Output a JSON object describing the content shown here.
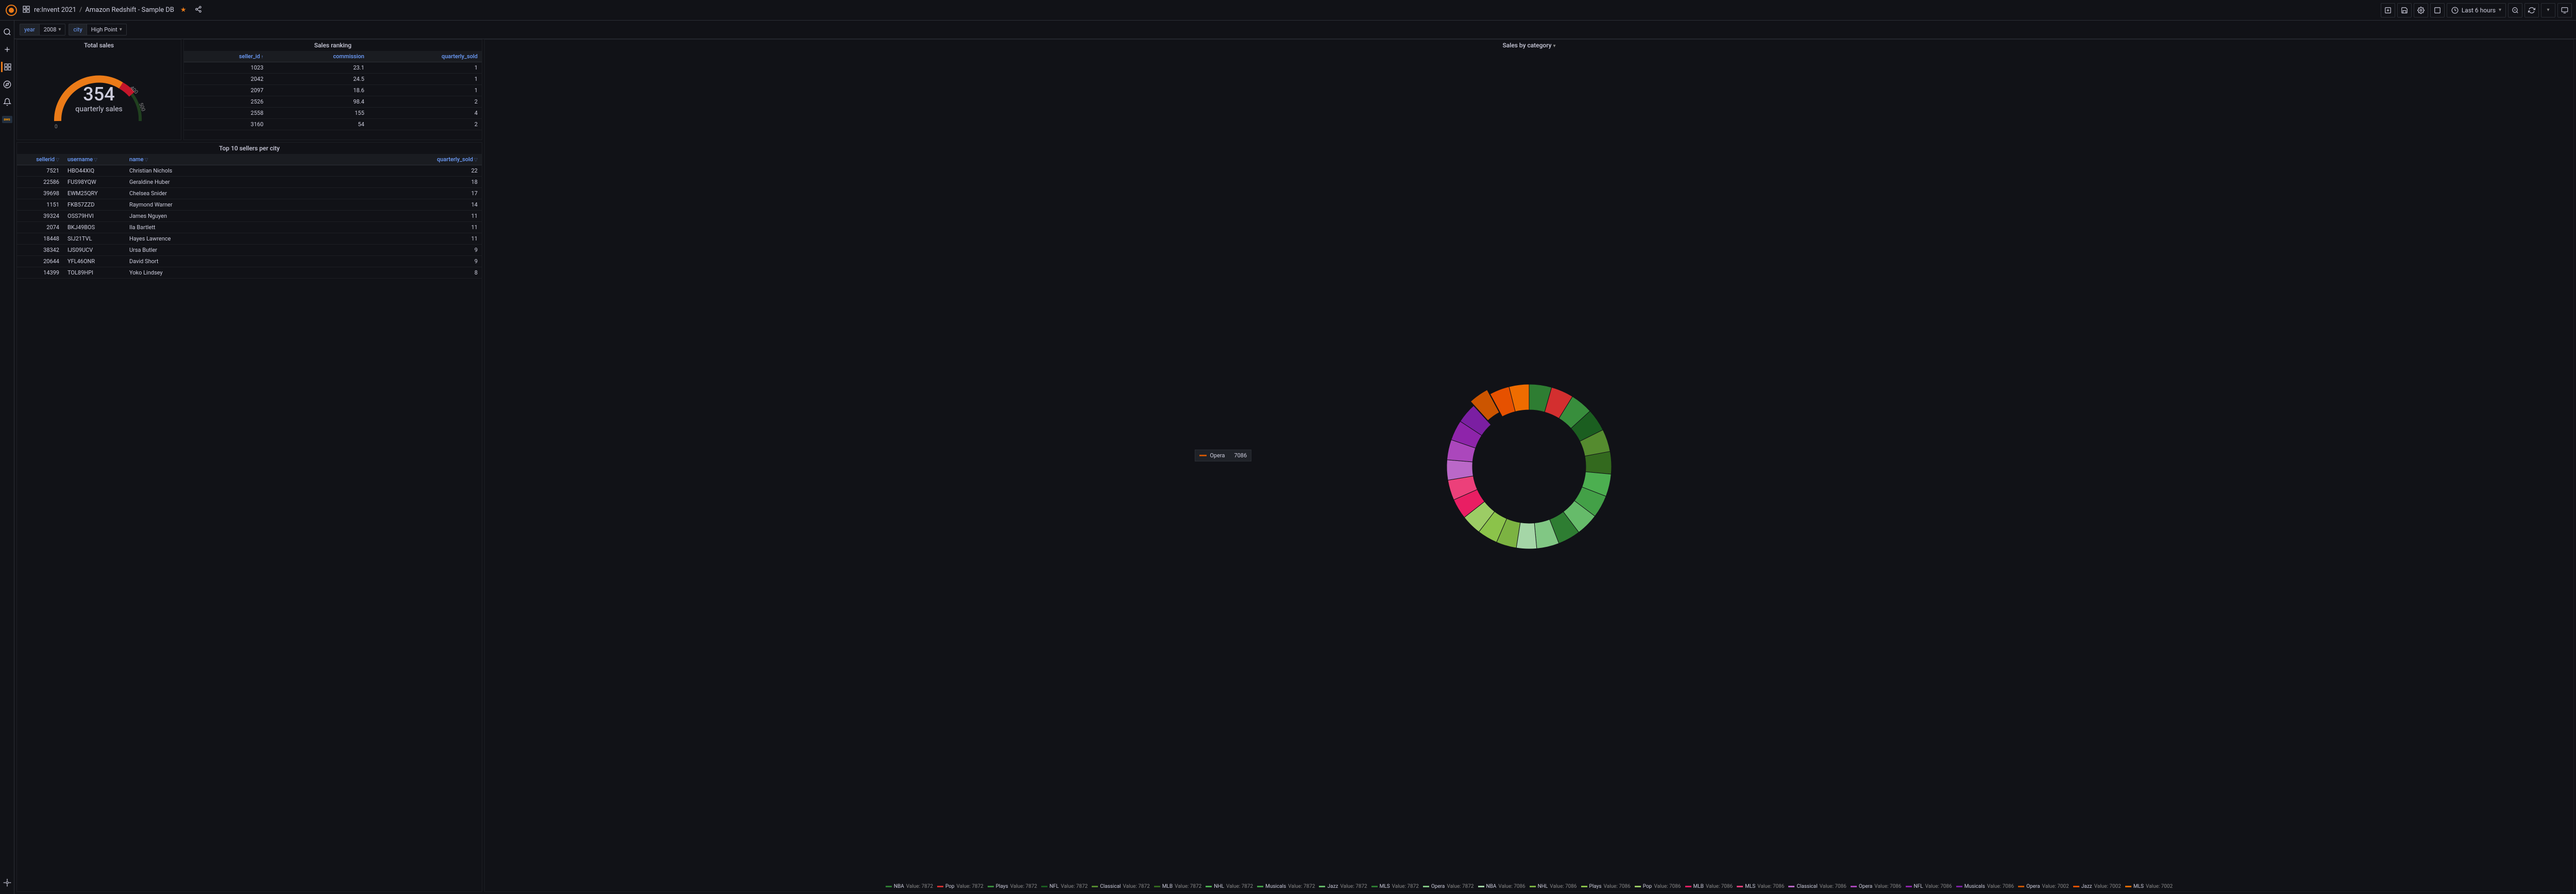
{
  "breadcrumb": {
    "icon": "dashboard",
    "folder": "re:Invent 2021",
    "title": "Amazon Redshift - Sample DB"
  },
  "time_picker": {
    "label": "Last 6 hours"
  },
  "variables": [
    {
      "label": "year",
      "value": "2008"
    },
    {
      "label": "city",
      "value": "High Point"
    }
  ],
  "panels": {
    "total_sales": {
      "title": "Total sales",
      "value": "354",
      "label": "quarterly sales",
      "ticks": [
        "0",
        "400",
        "500"
      ]
    },
    "sales_ranking": {
      "title": "Sales ranking",
      "columns": [
        "seller_id",
        "commission",
        "quarterly_sold"
      ],
      "sort_col": "seller_id",
      "rows": [
        {
          "seller_id": "1023",
          "commission": "23.1",
          "quarterly_sold": "1"
        },
        {
          "seller_id": "2042",
          "commission": "24.5",
          "quarterly_sold": "1"
        },
        {
          "seller_id": "2097",
          "commission": "18.6",
          "quarterly_sold": "1"
        },
        {
          "seller_id": "2526",
          "commission": "98.4",
          "quarterly_sold": "2"
        },
        {
          "seller_id": "2558",
          "commission": "155",
          "quarterly_sold": "4"
        },
        {
          "seller_id": "3160",
          "commission": "54",
          "quarterly_sold": "2"
        }
      ]
    },
    "top10": {
      "title": "Top 10 sellers per city",
      "columns": [
        "sellerid",
        "username",
        "name",
        "quarterly_sold"
      ],
      "rows": [
        {
          "sellerid": "7521",
          "username": "HBO44XIQ",
          "name": "Christian Nichols",
          "quarterly_sold": "22"
        },
        {
          "sellerid": "22586",
          "username": "FUS98YQW",
          "name": "Geraldine Huber",
          "quarterly_sold": "18"
        },
        {
          "sellerid": "39698",
          "username": "EWM25QRY",
          "name": "Chelsea Snider",
          "quarterly_sold": "17"
        },
        {
          "sellerid": "1151",
          "username": "FKB57ZZD",
          "name": "Raymond Warner",
          "quarterly_sold": "14"
        },
        {
          "sellerid": "39324",
          "username": "OSS79HVI",
          "name": "James Nguyen",
          "quarterly_sold": "11"
        },
        {
          "sellerid": "2074",
          "username": "BKJ49BOS",
          "name": "Ila Bartlett",
          "quarterly_sold": "11"
        },
        {
          "sellerid": "18448",
          "username": "SIJ21TVL",
          "name": "Hayes Lawrence",
          "quarterly_sold": "11"
        },
        {
          "sellerid": "38342",
          "username": "IJS09UCV",
          "name": "Ursa Butler",
          "quarterly_sold": "9"
        },
        {
          "sellerid": "20644",
          "username": "YFL46ONR",
          "name": "David Short",
          "quarterly_sold": "9"
        },
        {
          "sellerid": "14399",
          "username": "TOL89HPI",
          "name": "Yoko Lindsey",
          "quarterly_sold": "8"
        }
      ]
    },
    "sales_category": {
      "title": "Sales by category",
      "tooltip": {
        "label": "Opera",
        "value": "7086"
      }
    }
  },
  "chart_data": {
    "gauge": {
      "type": "gauge",
      "value": 354,
      "min": 0,
      "max": 500,
      "thresholds": [
        {
          "from": 0,
          "to": 354,
          "color": "#eb7b18"
        },
        {
          "from": 354,
          "to": 400,
          "color": "#c4162a"
        },
        {
          "from": 400,
          "to": 500,
          "color": "#37872d"
        }
      ]
    },
    "donut": {
      "type": "pie",
      "title": "Sales by category",
      "series": [
        {
          "name": "NBA",
          "value": 7872,
          "color": "#2e7d32"
        },
        {
          "name": "Pop",
          "value": 7872,
          "color": "#d32f2f"
        },
        {
          "name": "Plays",
          "value": 7872,
          "color": "#388e3c"
        },
        {
          "name": "NFL",
          "value": 7872,
          "color": "#1b5e20"
        },
        {
          "name": "Classical",
          "value": 7872,
          "color": "#558b2f"
        },
        {
          "name": "MLB",
          "value": 7872,
          "color": "#33691e"
        },
        {
          "name": "NHL",
          "value": 7872,
          "color": "#4caf50"
        },
        {
          "name": "Musicals",
          "value": 7872,
          "color": "#43a047"
        },
        {
          "name": "Jazz",
          "value": 7872,
          "color": "#66bb6a"
        },
        {
          "name": "MLS",
          "value": 7872,
          "color": "#2e7d32"
        },
        {
          "name": "Opera",
          "value": 7872,
          "color": "#81c784"
        },
        {
          "name": "NBA",
          "value": 7086,
          "color": "#a5d6a7"
        },
        {
          "name": "NHL",
          "value": 7086,
          "color": "#7cb342"
        },
        {
          "name": "Plays",
          "value": 7086,
          "color": "#8bc34a"
        },
        {
          "name": "Pop",
          "value": 7086,
          "color": "#9ccc65"
        },
        {
          "name": "MLB",
          "value": 7086,
          "color": "#e91e63"
        },
        {
          "name": "MLS",
          "value": 7086,
          "color": "#ec407a"
        },
        {
          "name": "Classical",
          "value": 7086,
          "color": "#ba68c8"
        },
        {
          "name": "Opera",
          "value": 7086,
          "color": "#ab47bc"
        },
        {
          "name": "NFL",
          "value": 7086,
          "color": "#8e24aa"
        },
        {
          "name": "Musicals",
          "value": 7086,
          "color": "#7b1fa2"
        },
        {
          "name": "Opera",
          "value": 7002,
          "color": "#cc5500"
        },
        {
          "name": "Jazz",
          "value": 7002,
          "color": "#e65100"
        },
        {
          "name": "MLS",
          "value": 7002,
          "color": "#ef6c00"
        }
      ]
    }
  }
}
